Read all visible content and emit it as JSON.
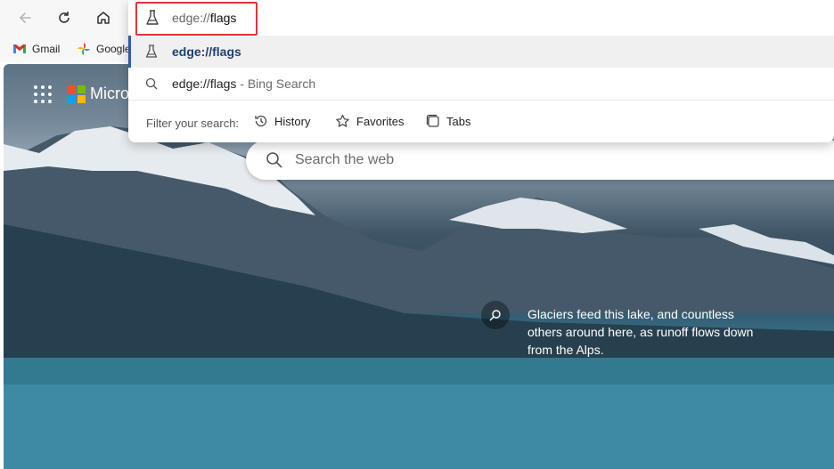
{
  "browser": {
    "address_value": "edge://flags",
    "address_prefix": "edge://",
    "address_suffix": "flags"
  },
  "bookmarks": [
    {
      "label": "Gmail",
      "icon": "gmail-icon"
    },
    {
      "label": "Google",
      "icon": "google-photos-icon"
    }
  ],
  "omnibox": {
    "suggestions": [
      {
        "text": "edge://flags",
        "icon": "flask-icon"
      },
      {
        "text": "edge://flags",
        "suffix": " - Bing Search",
        "icon": "search-icon"
      }
    ],
    "filter_label": "Filter your search:",
    "filters": [
      {
        "label": "History",
        "icon": "history-icon"
      },
      {
        "label": "Favorites",
        "icon": "star-icon"
      },
      {
        "label": "Tabs",
        "icon": "tabs-icon"
      }
    ]
  },
  "newtab": {
    "brand": "Micro",
    "search_placeholder": "Search the web",
    "caption": "Glaciers feed this lake, and countless others around here, as runoff flows down from the Alps."
  },
  "colors": {
    "accent": "#2b5aa8",
    "highlight_box": "#e0353a"
  }
}
